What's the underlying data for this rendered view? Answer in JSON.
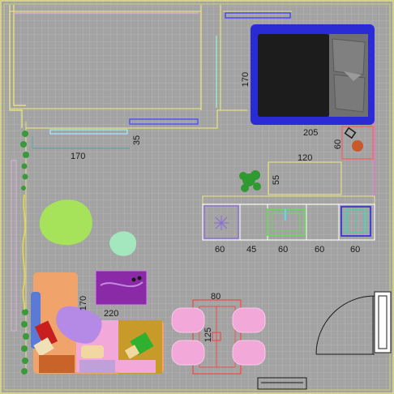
{
  "plan": {
    "view": "top-down floor plan",
    "colors": {
      "background": "#a3a3a3",
      "grid": "#b6b6b6",
      "wall_outline": "#e6e082",
      "bed_frame": "#2b2bd6",
      "mattress": "#1c1c1c",
      "pillow": "#707070",
      "rug_green": "#a6e35a",
      "rug_mint": "#a4e6be",
      "sofa_orange": "#f0a36a",
      "pouf_pink": "#f2a9d9",
      "kitchen_outline": "#ffffff"
    },
    "dimensions": {
      "top_left_width": "170",
      "bed_height": "170",
      "bed_width": "205",
      "nightstand": "60",
      "left_wall_depth": "35",
      "counter_width": "120",
      "counter_depth": "55",
      "kitchen_1": "60",
      "kitchen_2": "45",
      "kitchen_3": "60",
      "kitchen_4": "60",
      "kitchen_5": "60",
      "sofa_depth": "170",
      "sofa_width": "220",
      "table_width": "80",
      "table_depth": "125"
    },
    "furniture": [
      "wardrobe",
      "bed",
      "nightstand",
      "plant",
      "counter",
      "hob",
      "sink",
      "dishwasher",
      "rug-round-green",
      "rug-round-mint",
      "ottoman",
      "sofa",
      "dining-table",
      "chair",
      "door",
      "radiator"
    ]
  }
}
